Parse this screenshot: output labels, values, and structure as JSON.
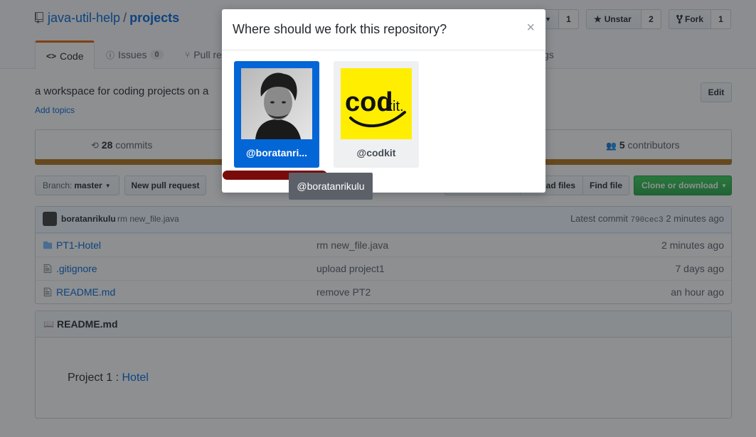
{
  "repo": {
    "owner": "java-util-help",
    "separator": "/",
    "name": "projects"
  },
  "header_actions": {
    "watch_count": "1",
    "unstar_label": "Unstar",
    "star_count": "2",
    "fork_label": "Fork",
    "fork_count": "1"
  },
  "tabs": [
    {
      "label": "Code"
    },
    {
      "label": "Issues",
      "counter": "0"
    },
    {
      "label": "Pull re"
    },
    {
      "label": "gs"
    }
  ],
  "description": "a workspace for coding projects on a",
  "add_topics": "Add topics",
  "edit_label": "Edit",
  "summary": {
    "commits_count": "28",
    "commits_label": "commits",
    "contributors_count": "5",
    "contributors_label": "contributors"
  },
  "toolbar": {
    "branch_prefix": "Branch:",
    "branch_name": "master",
    "new_pr": "New pull request",
    "upload_files": "ad files",
    "find_file": "Find file",
    "clone": "Clone or download"
  },
  "commit_tease": {
    "author": "boratanrikulu",
    "message": "rm new_file.java",
    "latest_label": "Latest commit",
    "sha": "790cec3",
    "age": "2 minutes ago"
  },
  "files": [
    {
      "name": "PT1-Hotel",
      "message": "rm new_file.java",
      "age": "2 minutes ago",
      "type": "folder"
    },
    {
      "name": ".gitignore",
      "message": "upload project1",
      "age": "7 days ago",
      "type": "file"
    },
    {
      "name": "README.md",
      "message": "remove PT2",
      "age": "an hour ago",
      "type": "file"
    }
  ],
  "readme": {
    "title": "README.md",
    "text_prefix": "Project 1 : ",
    "link": "Hotel"
  },
  "modal": {
    "title": "Where should we fork this repository?",
    "close": "×",
    "accounts": [
      {
        "label": "@boratanri..."
      },
      {
        "label": "@codkit",
        "logo_text_a": "cod",
        "logo_text_b": "kit."
      }
    ]
  },
  "tooltip": "@boratanrikulu",
  "colors": {
    "accent": "#0366d6",
    "clone_green": "#28a745",
    "language_bar": "#b07219",
    "tab_underline": "#e36209",
    "scribble": "#7a0b0b",
    "codkit_yellow": "#ffee00"
  }
}
